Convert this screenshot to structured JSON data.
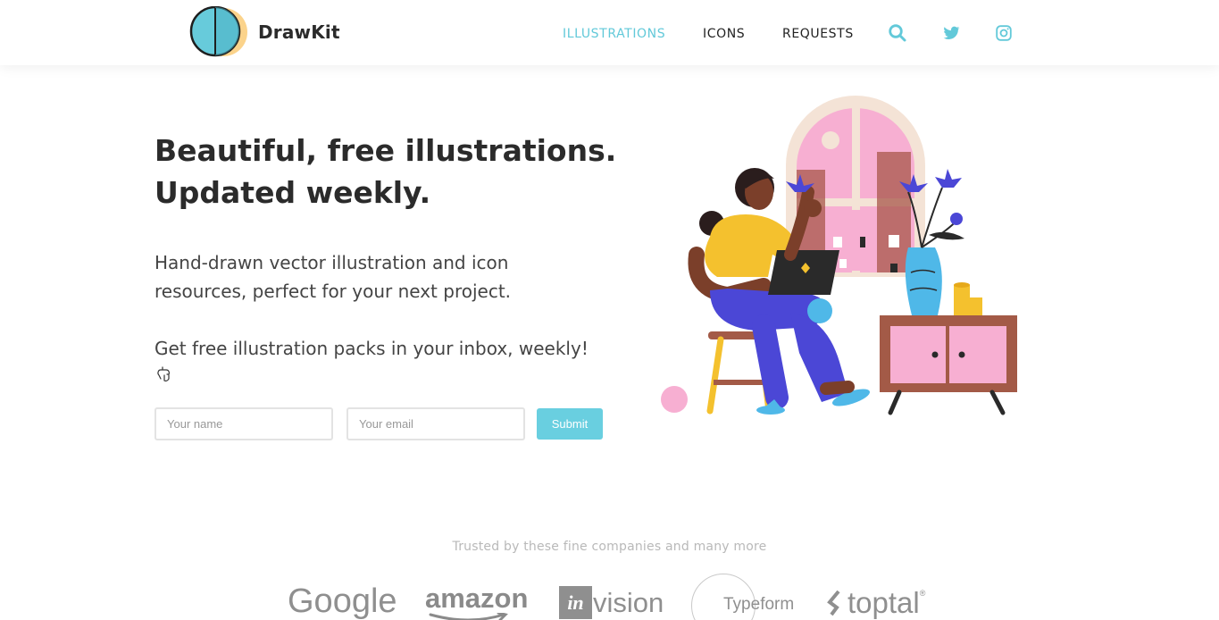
{
  "brand": {
    "name": "DrawKit"
  },
  "nav": {
    "items": [
      {
        "label": "ILLUSTRATIONS",
        "active": true
      },
      {
        "label": "ICONS",
        "active": false
      },
      {
        "label": "REQUESTS",
        "active": false
      }
    ],
    "icons": [
      "search-icon",
      "twitter-icon",
      "instagram-icon"
    ]
  },
  "hero": {
    "title_line1": "Beautiful, free illustrations.",
    "title_line2": "Updated weekly.",
    "description": "Hand-drawn vector illustration and icon resources, perfect for your next project.",
    "cta": "Get free illustration packs in your inbox, weekly!"
  },
  "form": {
    "name_placeholder": "Your name",
    "email_placeholder": "Your email",
    "submit_label": "Submit"
  },
  "trusted": {
    "text": "Trusted by these fine companies and many more",
    "logos": {
      "google": "Google",
      "amazon": "amazon",
      "invision_box": "in",
      "invision_word": "vision",
      "typeform": "Typeform",
      "toptal": "toptal",
      "toptal_mark": "®"
    }
  },
  "colors": {
    "accent": "#62c9d9",
    "button": "#69cfe0",
    "text": "#2b2b2b"
  }
}
